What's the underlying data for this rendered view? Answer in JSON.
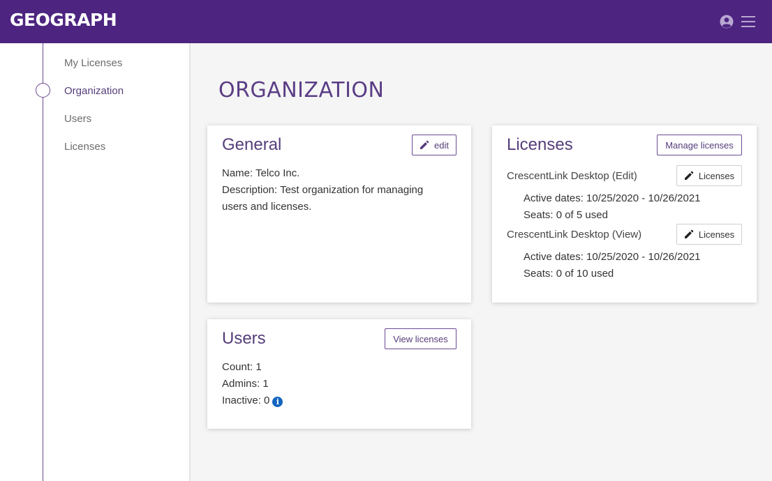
{
  "header": {
    "logo": "GEOGRAPH",
    "user_icon": "user-circle-icon",
    "menu_icon": "hamburger-menu-icon"
  },
  "sidebar": {
    "items": [
      {
        "label": "My Licenses",
        "active": false
      },
      {
        "label": "Organization",
        "active": true
      },
      {
        "label": "Users",
        "active": false
      },
      {
        "label": "Licenses",
        "active": false
      }
    ]
  },
  "page": {
    "title": "ORGANIZATION"
  },
  "general": {
    "title": "General",
    "edit_label": "edit",
    "name": "Name: Telco Inc.",
    "description_line1": "Description: Test organization for managing",
    "description_line2": "users and licenses."
  },
  "licenses": {
    "title": "Licenses",
    "manage_label": "Manage licenses",
    "items": [
      {
        "name": "CrescentLink Desktop (Edit)",
        "button_label": "Licenses",
        "active_dates": "Active dates: 10/25/2020 - 10/26/2021",
        "seats": "Seats: 0 of 5 used"
      },
      {
        "name": "CrescentLink Desktop (View)",
        "button_label": "Licenses",
        "active_dates": "Active dates: 10/25/2020 - 10/26/2021",
        "seats": "Seats: 0 of 10 used"
      }
    ]
  },
  "users": {
    "title": "Users",
    "view_label": "View licenses",
    "count": "Count: 1",
    "admins": "Admins: 1",
    "inactive": "Inactive: 0"
  },
  "colors": {
    "brand": "#4d2480",
    "accent_text": "#553d7a",
    "info": "#1565c0"
  }
}
